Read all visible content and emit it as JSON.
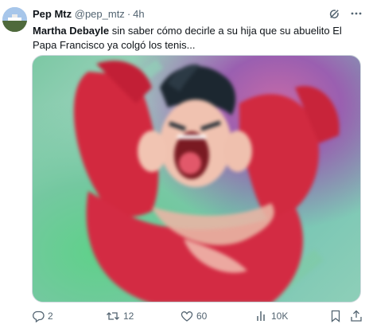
{
  "tweet": {
    "display_name": "Pep Mtz",
    "handle": "@pep_mtz",
    "separator": "·",
    "time": "4h",
    "text_mention": "Martha Debayle",
    "text_body": " sin saber cómo decirle a su hija que su abuelito El Papa Francisco ya colgó los tenis..."
  },
  "actions": {
    "replies": "2",
    "reposts": "12",
    "likes": "60",
    "views": "10K"
  },
  "icons": {
    "grok": "grok-icon",
    "more": "more-icon",
    "reply": "reply-icon",
    "repost": "repost-icon",
    "like": "heart-icon",
    "views": "views-icon",
    "bookmark": "bookmark-icon",
    "share": "share-icon"
  },
  "colors": {
    "text_primary": "#0f1419",
    "text_secondary": "#536471",
    "border": "#cfd9de"
  }
}
